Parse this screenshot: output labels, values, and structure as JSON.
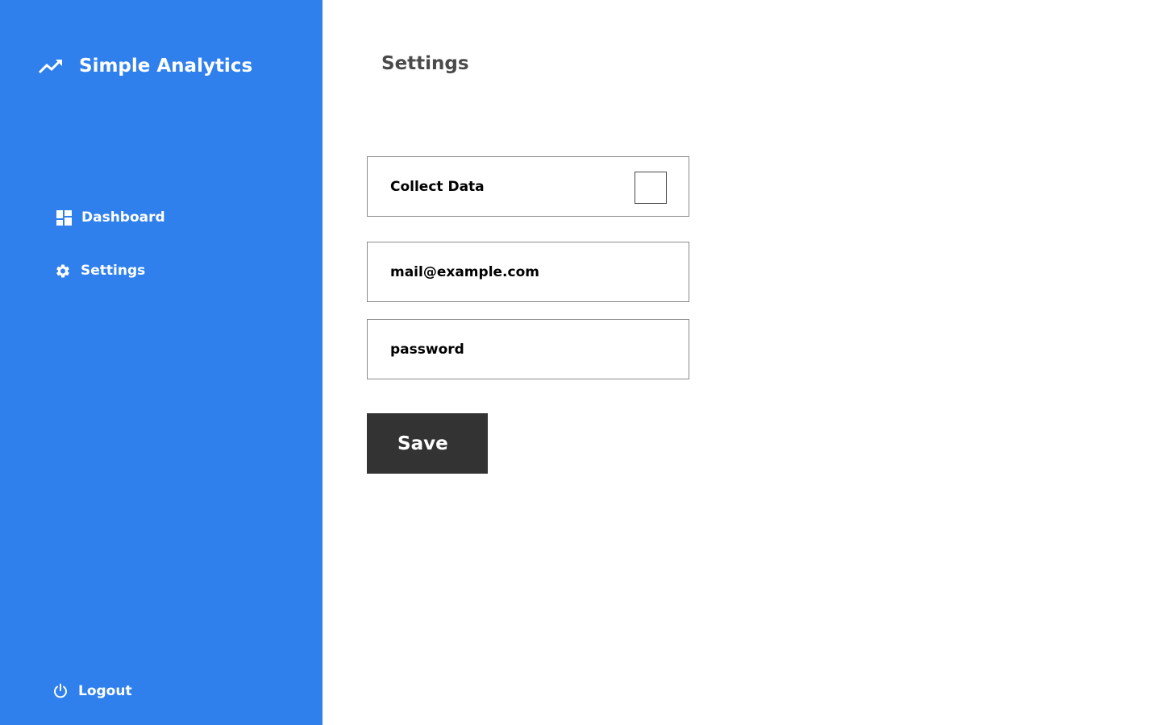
{
  "app": {
    "title": "Simple Analytics",
    "brand_icon": "trending-up-icon",
    "accent_color": "#2f80ed"
  },
  "sidebar": {
    "items": [
      {
        "label": "Dashboard",
        "icon": "dashboard-icon"
      },
      {
        "label": "Settings",
        "icon": "gear-icon"
      }
    ],
    "logout": {
      "label": "Logout",
      "icon": "power-icon"
    }
  },
  "main": {
    "title": "Settings",
    "collect_data": {
      "label": "Collect Data",
      "checked": false
    },
    "email": {
      "value": "mail@example.com"
    },
    "password": {
      "value": "password"
    },
    "save_label": "Save",
    "save_color": "#333333"
  }
}
